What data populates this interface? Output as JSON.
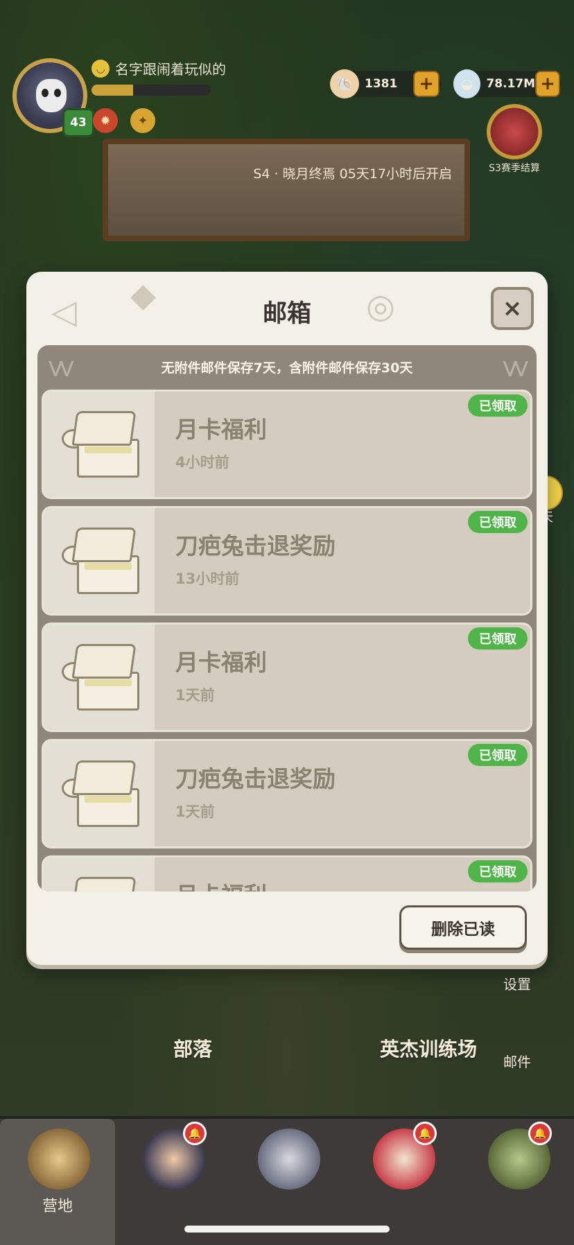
{
  "hud": {
    "player_name": "名字跟闹着玩似的",
    "level": "43",
    "xp_progress": 0.35,
    "currency_shells": "1381",
    "currency_gems": "78.17M",
    "plus": "+"
  },
  "season": {
    "banner_text": "S4 · 晓月终焉 05天17小时后开启",
    "badge_label": "S3赛季结算"
  },
  "side": {
    "chat_label": "聊天",
    "settings_label": "设置",
    "mail_label": "邮件"
  },
  "modal": {
    "title": "邮箱",
    "close_icon": "×",
    "notice": "无附件邮件保存7天，含附件邮件保存30天",
    "delete_read_label": "删除已读",
    "mails": [
      {
        "title": "月卡福利",
        "time": "4小时前",
        "status": "已领取"
      },
      {
        "title": "刀疤兔击退奖励",
        "time": "13小时前",
        "status": "已领取"
      },
      {
        "title": "月卡福利",
        "time": "1天前",
        "status": "已领取"
      },
      {
        "title": "刀疤兔击退奖励",
        "time": "1天前",
        "status": "已领取"
      },
      {
        "title": "月卡福利",
        "time": "",
        "status": "已领取"
      }
    ]
  },
  "scene": {
    "tribe_label": "部落",
    "training_label": "英杰训练场"
  },
  "tabbar": {
    "tabs": [
      {
        "label": "营地",
        "active": true
      },
      {
        "label": "",
        "active": false
      },
      {
        "label": "",
        "active": false
      },
      {
        "label": "",
        "active": false
      },
      {
        "label": "",
        "active": false
      }
    ]
  },
  "colors": {
    "accent_green": "#4fb548",
    "modal_bg": "#f3f0e7",
    "panel_bg": "#8f877b"
  }
}
